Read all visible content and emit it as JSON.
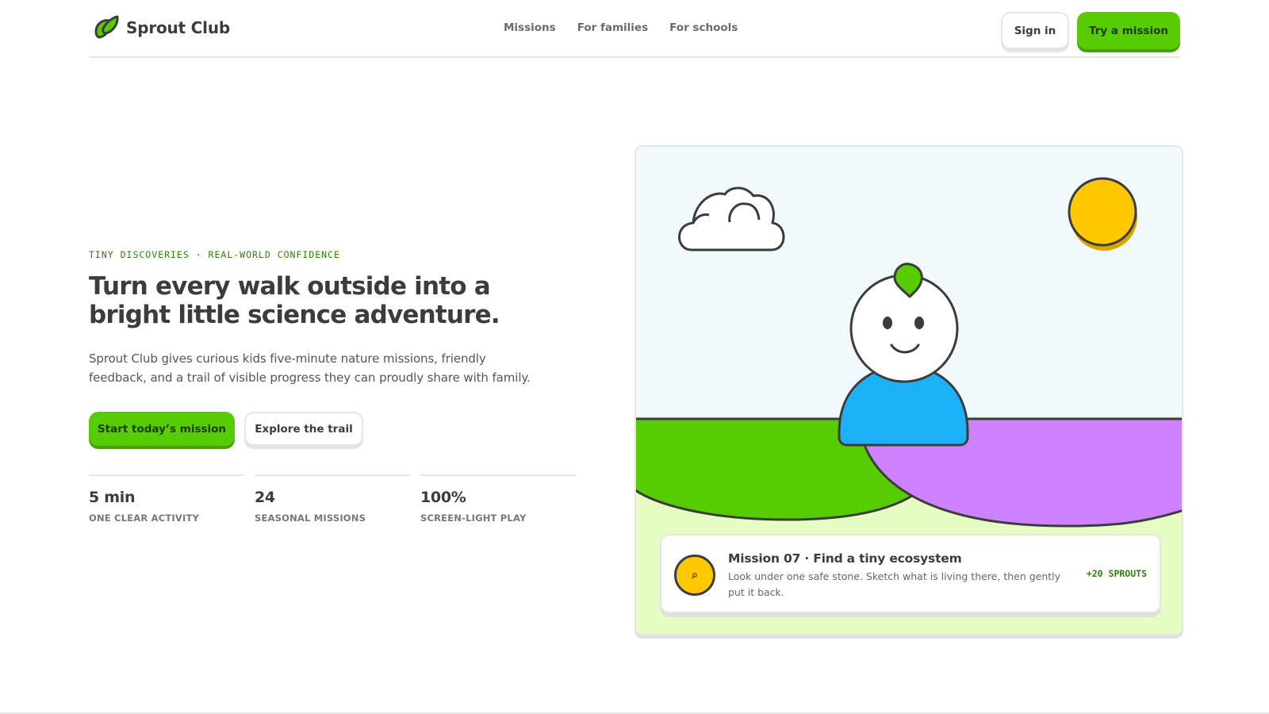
{
  "brand": {
    "name": "Sprout Club",
    "logo_icon": "leaf-icon",
    "accent": "#58cc02"
  },
  "nav": [
    {
      "label": "Missions"
    },
    {
      "label": "For families"
    },
    {
      "label": "For schools"
    }
  ],
  "header_actions": {
    "signin_label": "Sign in",
    "try_label": "Try a mission"
  },
  "hero": {
    "eyebrow": "TINY DISCOVERIES · REAL-WORLD CONFIDENCE",
    "title": "Turn every walk outside into a bright little science adventure.",
    "subtitle": "Sprout Club gives curious kids five-minute nature missions, friendly feedback, and a trail of visible progress they can proudly share with family.",
    "primary_cta": "Start today’s mission",
    "secondary_cta": "Explore the trail",
    "stats": [
      {
        "value": "5 min",
        "label": "ONE CLEAR ACTIVITY"
      },
      {
        "value": "24",
        "label": "SEASONAL MISSIONS"
      },
      {
        "value": "100%",
        "label": "SCREEN-LIGHT PLAY"
      }
    ]
  },
  "illustration": {
    "colors": {
      "sky": "#f2f9fc",
      "grass": "#58cc02",
      "hill": "#ce82ff",
      "ground": "#e5fcc2",
      "sun": "#ffc800",
      "body": "#1cb0f6"
    }
  },
  "mission_card": {
    "icon": "magnifier-icon",
    "title": "Mission 07 · Find a tiny ecosystem",
    "description": "Look under one safe stone. Sketch what is living there, then gently put it back.",
    "reward": "+20 SPROUTS"
  }
}
